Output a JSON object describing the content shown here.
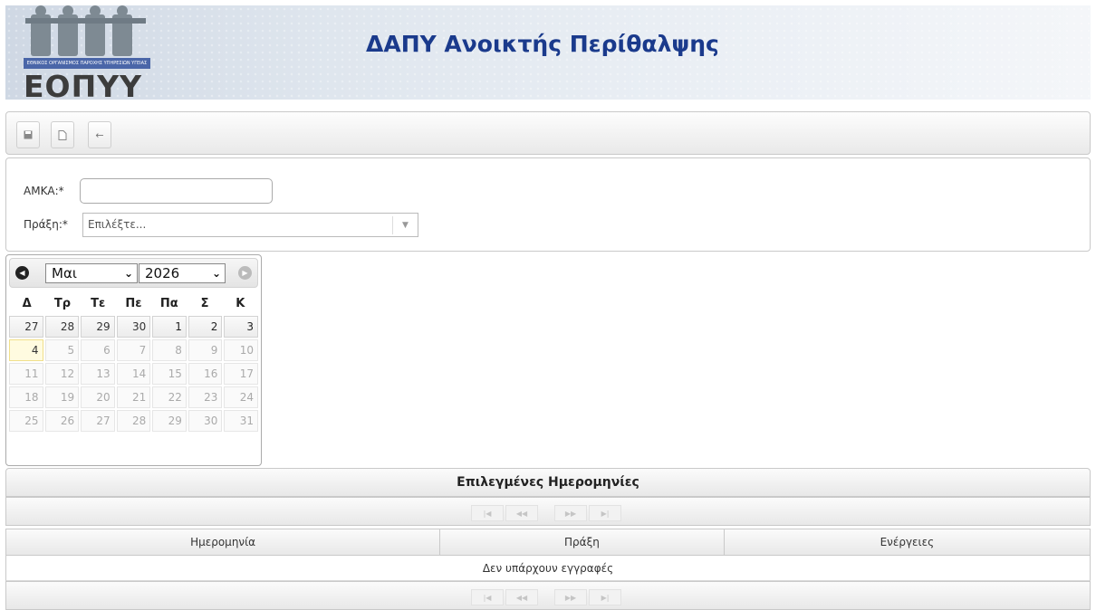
{
  "header": {
    "title": "ΔΑΠΥ Ανοικτής Περίθαλψης",
    "logo_text": "ΕΟΠΥΥ",
    "logo_strip": "ΕΘΝΙΚΟΣ ΟΡΓΑΝΙΣΜΟΣ ΠΑΡΟΧΗΣ ΥΠΗΡΕΣΙΩΝ ΥΓΕΙΑΣ"
  },
  "toolbar": {
    "icons": [
      "save-icon",
      "new-document-icon",
      "back-arrow-icon"
    ]
  },
  "form": {
    "amka_label": "ΑΜΚΑ:*",
    "amka_value": "",
    "praxi_label": "Πράξη:*",
    "praxi_placeholder": "Επιλέξτε..."
  },
  "calendar": {
    "month": "Μαι",
    "year": "2026",
    "weekdays": [
      "Δ",
      "Τρ",
      "Τε",
      "Πε",
      "Πα",
      "Σ",
      "Κ"
    ],
    "days": [
      "27",
      "28",
      "29",
      "30",
      "1",
      "2",
      "3",
      "4",
      "5",
      "6",
      "7",
      "8",
      "9",
      "10",
      "11",
      "12",
      "13",
      "14",
      "15",
      "16",
      "17",
      "18",
      "19",
      "20",
      "21",
      "22",
      "23",
      "24",
      "25",
      "26",
      "27",
      "28",
      "29",
      "30",
      "31"
    ]
  },
  "grid": {
    "title": "Επιλεγμένες Ημερομηνίες",
    "columns": [
      "Ημερομηνία",
      "Πράξη",
      "Ενέργειες"
    ],
    "empty_message": "Δεν υπάρχουν εγγραφές",
    "pager_icons": [
      "first-page-icon",
      "prev-page-icon",
      "next-page-icon",
      "last-page-icon"
    ]
  }
}
